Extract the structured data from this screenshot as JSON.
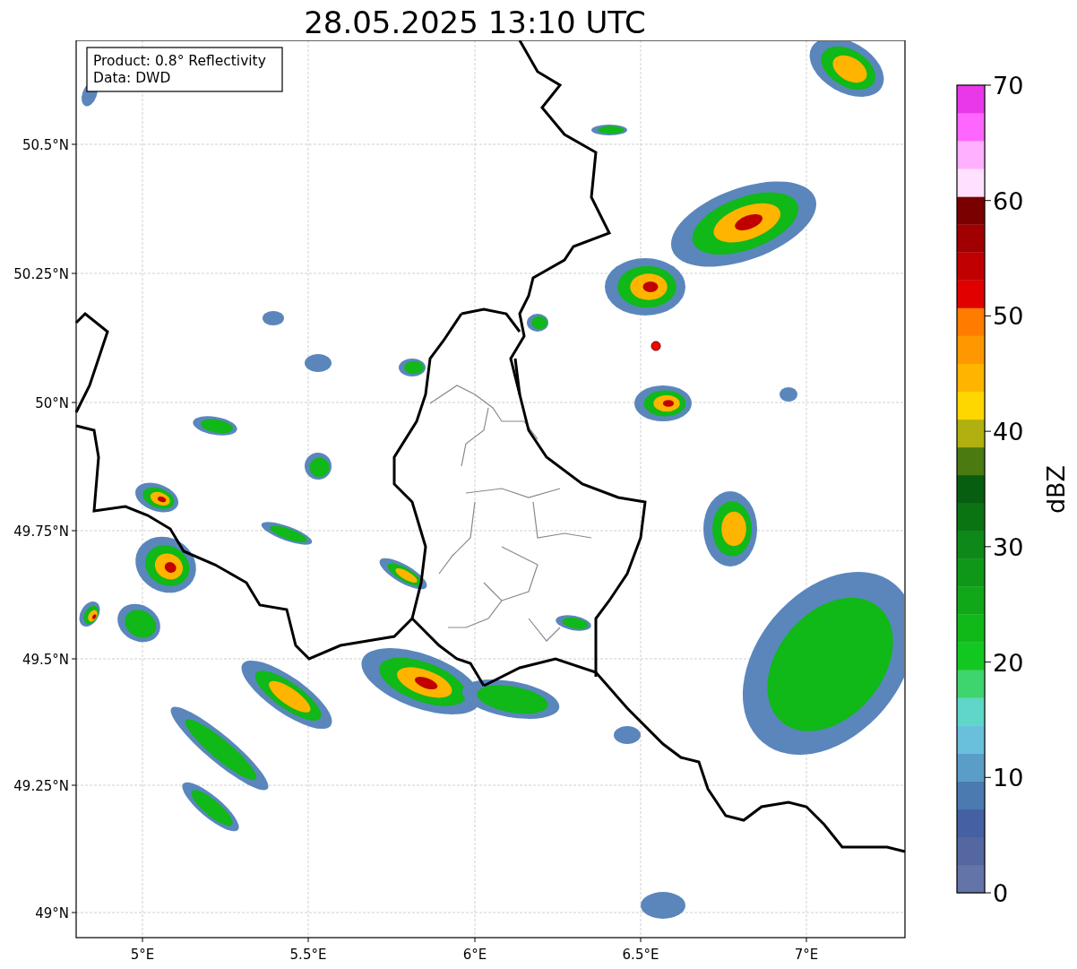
{
  "title": "28.05.2025 13:10 UTC",
  "info_box": {
    "lines": [
      "Product: 0.8° Reflectivity",
      "Data: DWD"
    ]
  },
  "map": {
    "y_ticks": [
      "50.5°N",
      "50.25°N",
      "50°N",
      "49.75°N",
      "49.5°N",
      "49.25°N",
      "49°N"
    ],
    "x_ticks": [
      "5°E",
      "5.5°E",
      "6°E",
      "6.5°E",
      "7°E"
    ]
  },
  "colorbar": {
    "label": "dBZ",
    "ticks": [
      "70",
      "60",
      "50",
      "40",
      "30",
      "20",
      "10",
      "0"
    ],
    "bins": [
      {
        "color": "#6374a8"
      },
      {
        "color": "#5467a0"
      },
      {
        "color": "#4561a3"
      },
      {
        "color": "#4a7ab0"
      },
      {
        "color": "#5a9ec8"
      },
      {
        "color": "#68c0dc"
      },
      {
        "color": "#5ed6c8"
      },
      {
        "color": "#3ed46e"
      },
      {
        "color": "#12c820"
      },
      {
        "color": "#10b818"
      },
      {
        "color": "#10a818"
      },
      {
        "color": "#0f9818"
      },
      {
        "color": "#0e8818"
      },
      {
        "color": "#0a7412"
      },
      {
        "color": "#085e10"
      },
      {
        "color": "#4a7a10"
      },
      {
        "color": "#b0b010"
      },
      {
        "color": "#ffd700"
      },
      {
        "color": "#ffb400"
      },
      {
        "color": "#ff9800"
      },
      {
        "color": "#ff7c00"
      },
      {
        "color": "#e00000"
      },
      {
        "color": "#c00000"
      },
      {
        "color": "#a00000"
      },
      {
        "color": "#7a0000"
      },
      {
        "color": "#ffe0ff"
      },
      {
        "color": "#ffb0ff"
      },
      {
        "color": "#ff66ff"
      },
      {
        "color": "#e838e8"
      }
    ]
  }
}
